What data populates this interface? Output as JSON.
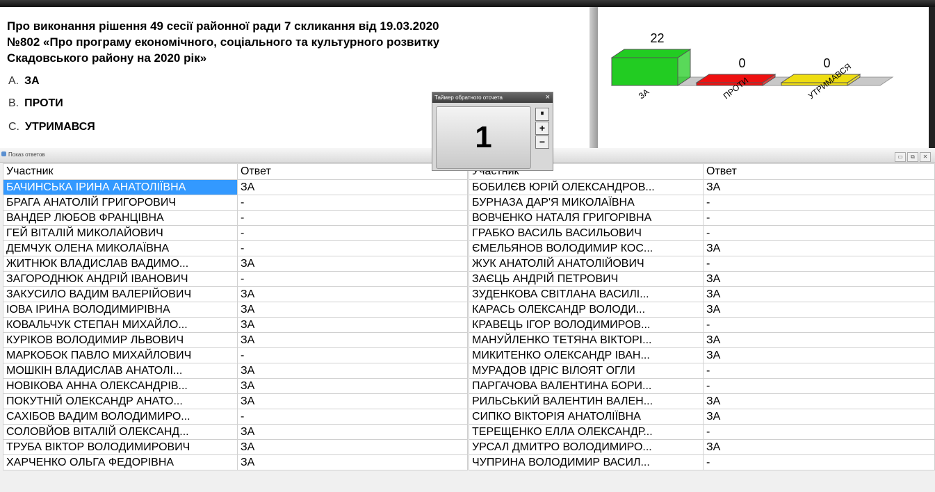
{
  "question": {
    "title": "Про виконання рішення 49 сесії районної ради 7 скликання від 19.03.2020\n№802 «Про програму економічного, соціального та культурного розвитку\nСкадовського району на 2020 рік»",
    "options": [
      {
        "letter": "A.",
        "text": "ЗА"
      },
      {
        "letter": "B.",
        "text": "ПРОТИ"
      },
      {
        "letter": "C.",
        "text": "УТРИМАВСЯ"
      }
    ]
  },
  "chart_data": {
    "type": "bar",
    "categories": [
      "ЗА",
      "ПРОТИ",
      "УТРИМАВСЯ"
    ],
    "values": [
      22,
      0,
      0
    ],
    "colors": [
      "#22cc22",
      "#ee1111",
      "#eedd11"
    ],
    "title": "",
    "xlabel": "",
    "ylabel": ""
  },
  "timer": {
    "title": "Таймер обратного отсчета",
    "value": "1",
    "close_icon": "×",
    "pause_icon": "⏸",
    "plus_label": "+",
    "minus_label": "−"
  },
  "answers_window": {
    "title": "Показ ответов",
    "minimize_icon": "▭",
    "restore_icon": "⧉",
    "close_icon": "✕"
  },
  "table": {
    "headers": {
      "participant": "Участник",
      "answer": "Ответ"
    },
    "left": [
      {
        "name": "БАЧИНСЬКА ІРИНА АНАТОЛІЇВНА",
        "answer": "ЗА"
      },
      {
        "name": "БРАГА АНАТОЛІЙ ГРИГОРОВИЧ",
        "answer": "-"
      },
      {
        "name": "ВАНДЕР ЛЮБОВ ФРАНЦІВНА",
        "answer": "-"
      },
      {
        "name": "ГЕЙ ВІТАЛІЙ МИКОЛАЙОВИЧ",
        "answer": "-"
      },
      {
        "name": "ДЕМЧУК ОЛЕНА МИКОЛАЇВНА",
        "answer": "-"
      },
      {
        "name": "ЖИТНЮК ВЛАДИСЛАВ ВАДИМО...",
        "answer": "ЗА"
      },
      {
        "name": "ЗАГОРОДНЮК АНДРІЙ ІВАНОВИЧ",
        "answer": "-"
      },
      {
        "name": "ЗАКУСИЛО ВАДИМ ВАЛЕРІЙОВИЧ",
        "answer": "ЗА"
      },
      {
        "name": "ІОВА ІРИНА ВОЛОДИМИРІВНА",
        "answer": "ЗА"
      },
      {
        "name": "КОВАЛЬЧУК СТЕПАН МИХАЙЛО...",
        "answer": "ЗА"
      },
      {
        "name": "КУРІКОВ ВОЛОДИМИР ЛЬВОВИЧ",
        "answer": "ЗА"
      },
      {
        "name": "МАРКОБОК ПАВЛО МИХАЙЛОВИЧ",
        "answer": "-"
      },
      {
        "name": "МОШКІН ВЛАДИСЛАВ АНАТОЛІ...",
        "answer": "ЗА"
      },
      {
        "name": "НОВІКОВА АННА ОЛЕКСАНДРІВ...",
        "answer": "ЗА"
      },
      {
        "name": "ПОКУТНІЙ ОЛЕКСАНДР АНАТО...",
        "answer": "ЗА"
      },
      {
        "name": "САХІБОВ ВАДИМ ВОЛОДИМИРО...",
        "answer": "-"
      },
      {
        "name": "СОЛОВЙОВ ВІТАЛІЙ ОЛЕКСАНД...",
        "answer": "ЗА"
      },
      {
        "name": "ТРУБА ВІКТОР ВОЛОДИМИРОВИЧ",
        "answer": "ЗА"
      },
      {
        "name": "ХАРЧЕНКО ОЛЬГА ФЕДОРІВНА",
        "answer": "ЗА"
      }
    ],
    "right": [
      {
        "name": "БОБИЛЄВ ЮРІЙ ОЛЕКСАНДРОВ...",
        "answer": "ЗА"
      },
      {
        "name": "БУРНАЗА ДАР'Я МИКОЛАЇВНА",
        "answer": "-"
      },
      {
        "name": "ВОВЧЕНКО НАТАЛЯ ГРИГОРІВНА",
        "answer": "-"
      },
      {
        "name": "ГРАБКО ВАСИЛЬ ВАСИЛЬОВИЧ",
        "answer": "-"
      },
      {
        "name": "ЄМЕЛЬЯНОВ ВОЛОДИМИР КОС...",
        "answer": "ЗА"
      },
      {
        "name": "ЖУК АНАТОЛІЙ АНАТОЛІЙОВИЧ",
        "answer": "-"
      },
      {
        "name": "ЗАЄЦЬ АНДРІЙ ПЕТРОВИЧ",
        "answer": "ЗА"
      },
      {
        "name": "ЗУДЕНКОВА СВІТЛАНА ВАСИЛІ...",
        "answer": "ЗА"
      },
      {
        "name": "КАРАСЬ ОЛЕКСАНДР ВОЛОДИ...",
        "answer": "ЗА"
      },
      {
        "name": "КРАВЕЦЬ ІГОР ВОЛОДИМИРОВ...",
        "answer": "-"
      },
      {
        "name": "МАНУЙЛЕНКО ТЕТЯНА ВІКТОРІ...",
        "answer": "ЗА"
      },
      {
        "name": "МИКИТЕНКО ОЛЕКСАНДР ІВАН...",
        "answer": "ЗА"
      },
      {
        "name": "МУРАДОВ ІДРІС ВІЛОЯТ ОГЛИ",
        "answer": "-"
      },
      {
        "name": "ПАРГАЧОВА ВАЛЕНТИНА БОРИ...",
        "answer": "-"
      },
      {
        "name": "РИЛЬСЬКИЙ ВАЛЕНТИН ВАЛЕН...",
        "answer": "ЗА"
      },
      {
        "name": "СИПКО ВІКТОРІЯ АНАТОЛІЇВНА",
        "answer": "ЗА"
      },
      {
        "name": "ТЕРЕЩЕНКО ЕЛЛА ОЛЕКСАНДР...",
        "answer": "-"
      },
      {
        "name": "УРСАЛ ДМИТРО ВОЛОДИМИРО...",
        "answer": "ЗА"
      },
      {
        "name": "ЧУПРИНА ВОЛОДИМИР ВАСИЛ...",
        "answer": "-"
      }
    ]
  }
}
